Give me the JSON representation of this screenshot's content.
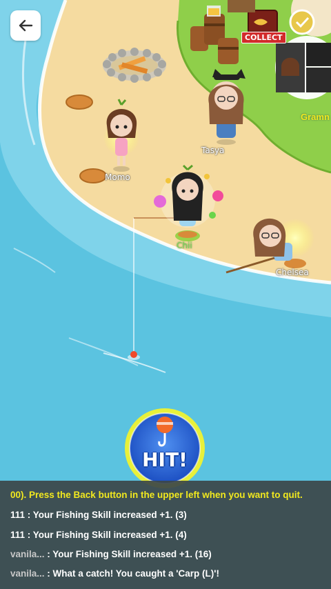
{
  "nav": {
    "back_label": "Back"
  },
  "players": [
    {
      "name": "Momo"
    },
    {
      "name": "Tasya"
    },
    {
      "name": "Chii"
    },
    {
      "name": "Chelsea"
    }
  ],
  "profile_card": {
    "name_partial": "Gramn"
  },
  "collect": {
    "label": "COLLECT"
  },
  "hit_button": {
    "label": "HIT!"
  },
  "chat": {
    "lines": [
      {
        "who": "",
        "text": "00). Press the Back button in the upper left when you want to quit.",
        "type": "system"
      },
      {
        "who": "111",
        "text": " : Your Fishing Skill increased +1. (3)",
        "type": "normal"
      },
      {
        "who": "111",
        "text": " : Your Fishing Skill increased +1. (4)",
        "type": "normal"
      },
      {
        "who": "vanila...",
        "text": " : Your Fishing Skill increased +1. (16)",
        "type": "muted"
      },
      {
        "who": "vanila...",
        "text": " : What a catch! You caught a 'Carp (L)'!",
        "type": "muted"
      }
    ]
  },
  "colors": {
    "sea": "#5bc3e0",
    "sand": "#f5dba0",
    "grass": "#8fcf4a",
    "hit_blue": "#2a6be0",
    "hit_ring": "#e8f03a",
    "system_text": "#f2e91e"
  }
}
